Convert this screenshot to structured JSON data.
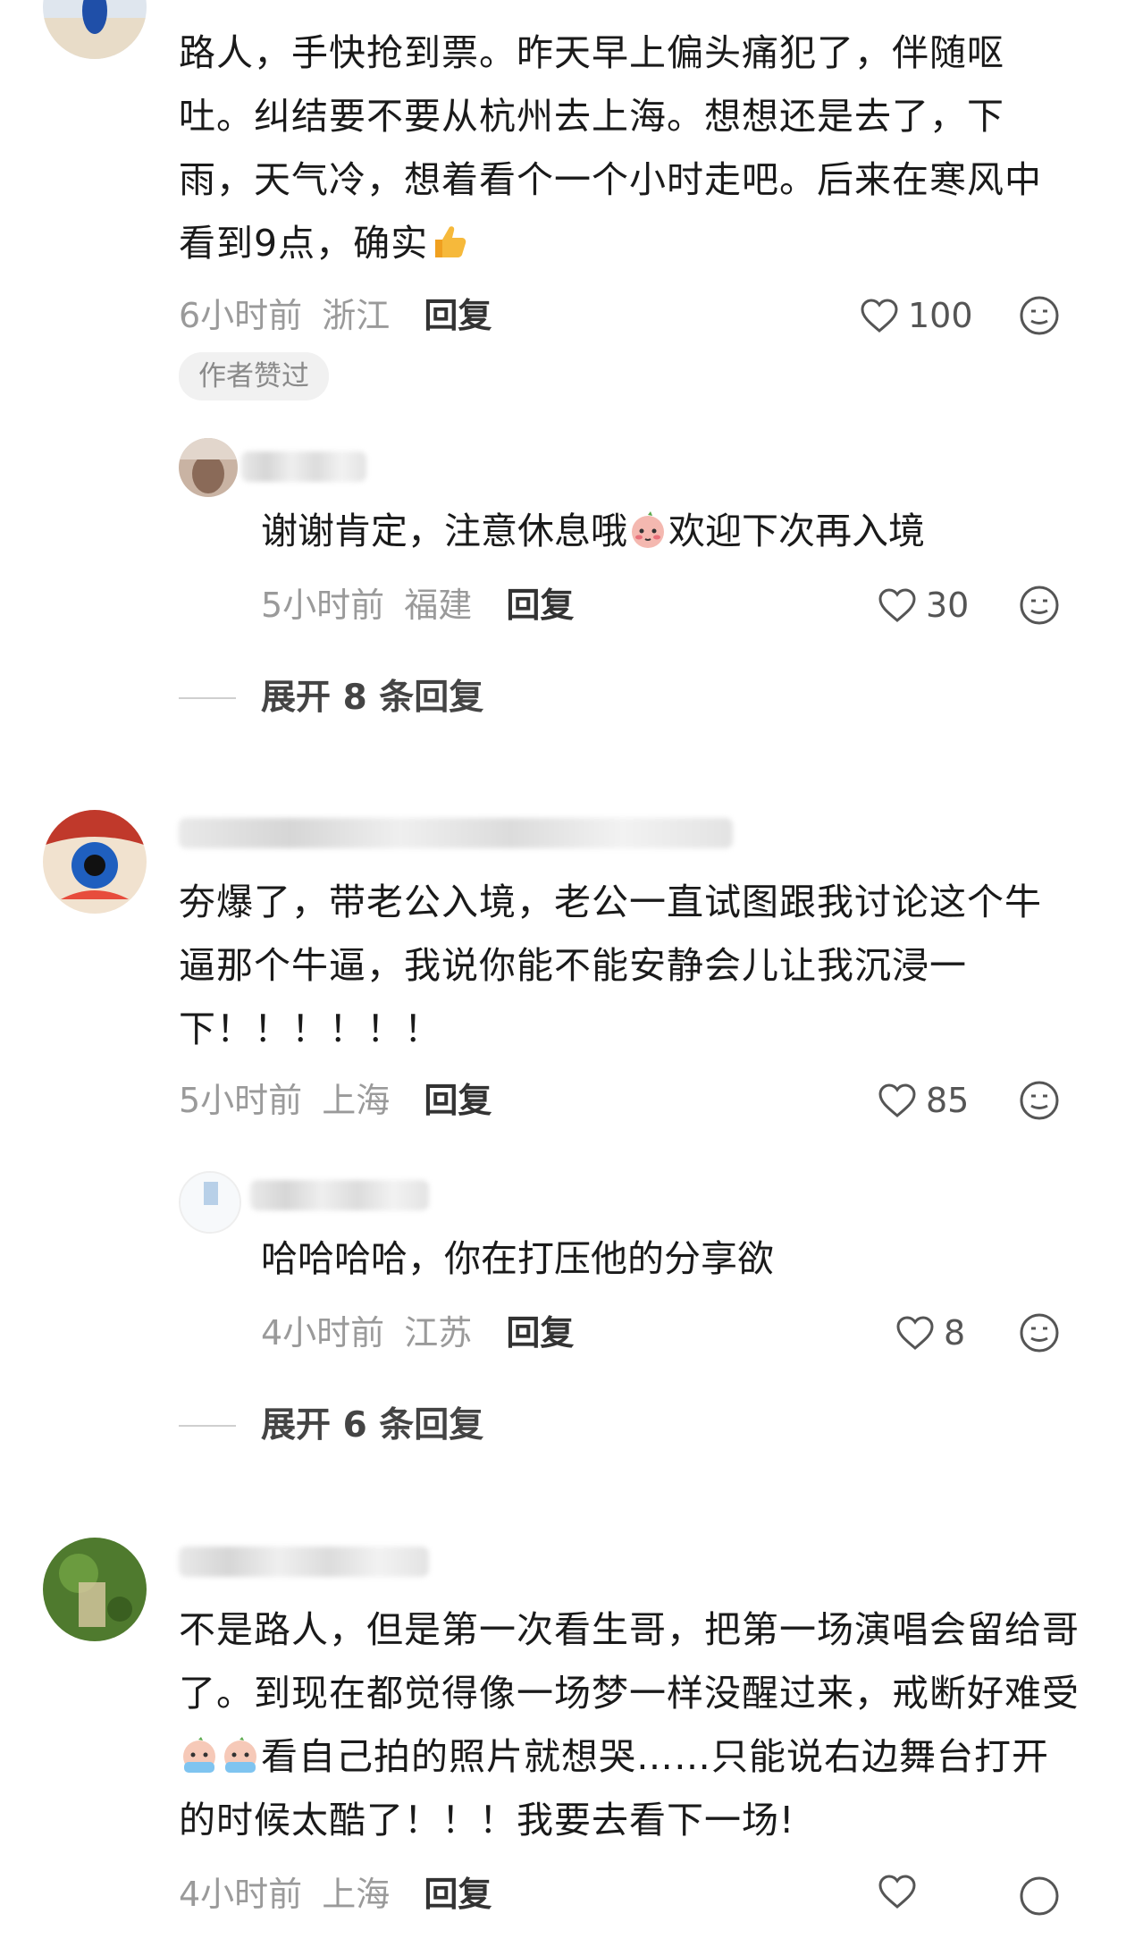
{
  "comments": [
    {
      "text": "路人，手快抢到票。昨天早上偏头痛犯了，伴随呕吐。纠结要不要从杭州去上海。想想还是去了，下雨，天气冷，想着看个一个小时走吧。后来在寒风中看到9点，确实",
      "emoji_end": "thumbs-up",
      "time": "6小时前",
      "location": "浙江",
      "reply_label": "回复",
      "likes": "100",
      "badge": "作者赞过",
      "reply": {
        "text_before": "谢谢肯定，注意休息哦",
        "text_after": "欢迎下次再入境",
        "time": "5小时前",
        "location": "福建",
        "reply_label": "回复",
        "likes": "30"
      },
      "expand_label": "展开 8 条回复"
    },
    {
      "text": "夯爆了，带老公入境，老公一直试图跟我讨论这个牛逼那个牛逼，我说你能不能安静会儿让我沉浸一下！！！！！！",
      "time": "5小时前",
      "location": "上海",
      "reply_label": "回复",
      "likes": "85",
      "reply": {
        "text": "哈哈哈哈，你在打压他的分享欲",
        "time": "4小时前",
        "location": "江苏",
        "reply_label": "回复",
        "likes": "8"
      },
      "expand_label": "展开 6 条回复"
    },
    {
      "text_part1": "不是路人，但是第一次看生哥，把第一场演唱会留给哥了。到现在都觉得像一场梦一样没醒过来，戒断好难受",
      "text_part2": "看自己拍的照片就想哭……只能说右边舞台打开的时候太酷了！！！我要去看下一场!",
      "time": "4小时前",
      "location": "上海",
      "reply_label": "回复"
    }
  ],
  "colors": {
    "meta_gray": "#9a9a9a",
    "text": "#1a1a1a",
    "badge_bg": "#f1f1f1"
  }
}
